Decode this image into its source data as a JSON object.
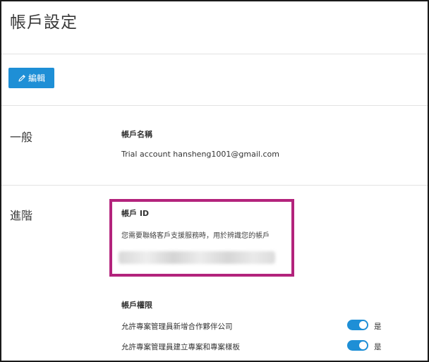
{
  "page": {
    "title": "帳戶設定"
  },
  "toolbar": {
    "edit_label": "編輯",
    "edit_icon": "pencil-icon"
  },
  "general": {
    "section_label": "一般",
    "account_name_label": "帳戶名稱",
    "account_name_value": "Trial account hansheng1001@gmail.com"
  },
  "advanced": {
    "section_label": "進階",
    "account_id_label": "帳戶 ID",
    "account_id_desc": "您需要聯絡客戶支援服務時，用於辨識您的帳戶",
    "permissions_label": "帳戶權限",
    "permissions": [
      {
        "label": "允許專案管理員新增合作夥伴公司",
        "value": "是",
        "enabled": true
      },
      {
        "label": "允許專案管理員建立專案和專案樣板",
        "value": "是",
        "enabled": true
      }
    ]
  },
  "colors": {
    "accent": "#1e8fd6",
    "highlight": "#b3237c",
    "divider": "#e2e2e2"
  }
}
